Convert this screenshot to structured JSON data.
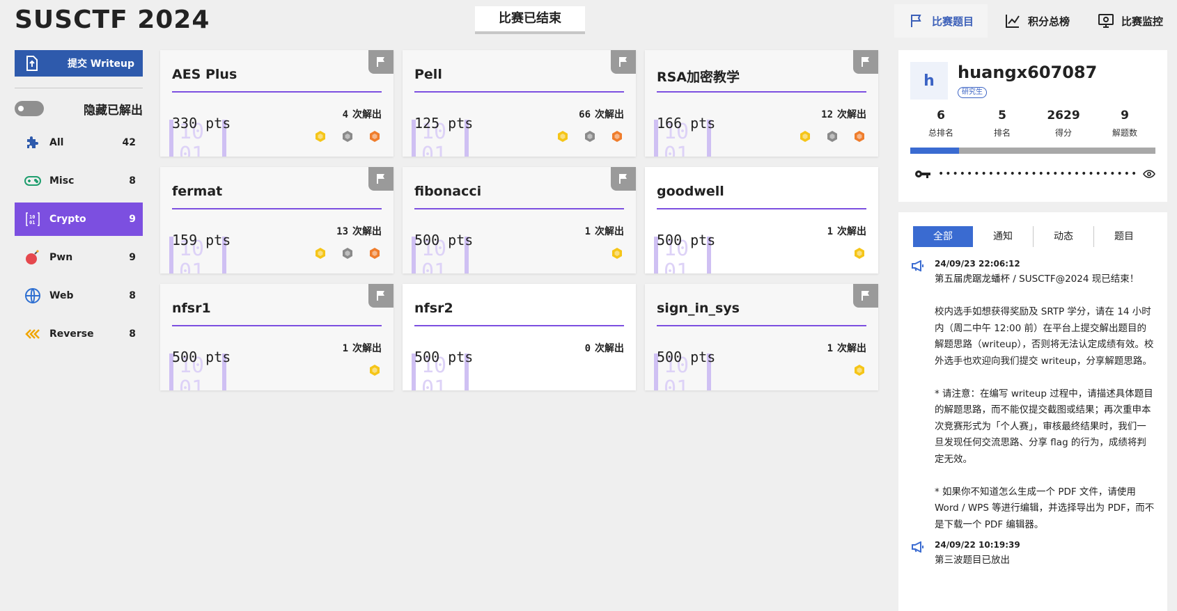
{
  "header": {
    "title": "SUSCTF 2024",
    "status": "比赛已结束",
    "nav": [
      {
        "label": "比赛题目",
        "icon": "flag-icon"
      },
      {
        "label": "积分总榜",
        "icon": "chart-icon"
      },
      {
        "label": "比赛监控",
        "icon": "monitor-icon"
      }
    ]
  },
  "sidebar": {
    "submit_label": "提交 Writeup",
    "hide_solved_label": "隐藏已解出",
    "categories": [
      {
        "name": "All",
        "count": "42",
        "icon": "puzzle-icon"
      },
      {
        "name": "Misc",
        "count": "8",
        "icon": "gamepad-icon"
      },
      {
        "name": "Crypto",
        "count": "9",
        "icon": "binary-icon"
      },
      {
        "name": "Pwn",
        "count": "9",
        "icon": "bomb-icon"
      },
      {
        "name": "Web",
        "count": "8",
        "icon": "globe-icon"
      },
      {
        "name": "Reverse",
        "count": "8",
        "icon": "chevrons-left-icon"
      }
    ]
  },
  "challenges": [
    {
      "title": "AES Plus",
      "pts": "330 pts",
      "solves": "4",
      "solves_label": "次解出"
    },
    {
      "title": "Pell",
      "pts": "125 pts",
      "solves": "66",
      "solves_label": "次解出"
    },
    {
      "title": "RSA加密教学",
      "pts": "166 pts",
      "solves": "12",
      "solves_label": "次解出"
    },
    {
      "title": "fermat",
      "pts": "159 pts",
      "solves": "13",
      "solves_label": "次解出"
    },
    {
      "title": "fibonacci",
      "pts": "500 pts",
      "solves": "1",
      "solves_label": "次解出"
    },
    {
      "title": "goodwell",
      "pts": "500 pts",
      "solves": "1",
      "solves_label": "次解出"
    },
    {
      "title": "nfsr1",
      "pts": "500 pts",
      "solves": "1",
      "solves_label": "次解出"
    },
    {
      "title": "nfsr2",
      "pts": "500 pts",
      "solves": "0",
      "solves_label": "次解出"
    },
    {
      "title": "sign_in_sys",
      "pts": "500 pts",
      "solves": "1",
      "solves_label": "次解出"
    }
  ],
  "user": {
    "avatar_letter": "h",
    "name": "huangx607087",
    "role": "研究生",
    "stats": [
      {
        "value": "6",
        "label": "总排名"
      },
      {
        "value": "5",
        "label": "排名"
      },
      {
        "value": "2629",
        "label": "得分"
      },
      {
        "value": "9",
        "label": "解题数"
      }
    ],
    "progress_percent": 20,
    "token_masked": "••••••••••••••••••••••••••••••"
  },
  "notices": {
    "tabs": [
      "全部",
      "通知",
      "动态",
      "题目"
    ],
    "items": [
      {
        "time": "24/09/23 22:06:12",
        "text": "第五届虎踞龙蟠杯 / SUSCTF@2024 现已结束！\n\n校内选手如想获得奖励及 SRTP 学分，请在 14 小时内（周二中午 12:00 前）在平台上提交解出题目的解题思路（writeup），否则将无法认定成绩有效。校外选手也欢迎向我们提交 writeup，分享解题思路。\n\n* 请注意：在编写 writeup 过程中，请描述具体题目的解题思路，而不能仅提交截图或结果；再次重申本次竞赛形式为「个人赛」，审核最终结果时，我们一旦发现任何交流思路、分享 flag 的行为，成绩将判定无效。\n\n* 如果你不知道怎么生成一个 PDF 文件，请使用 Word / WPS 等进行编辑，并选择导出为 PDF，而不是下载一个 PDF 编辑器。"
      },
      {
        "time": "24/09/22 10:19:39",
        "text": "第三波题目已放出"
      }
    ]
  },
  "colors": {
    "accent_purple": "#7c4fe0",
    "primary_blue": "#2e5aac",
    "tab_blue": "#3a6bd1",
    "medal_gold": "#f5c518",
    "medal_silver": "#8a8a8a",
    "medal_bronze": "#ef7d2c"
  }
}
